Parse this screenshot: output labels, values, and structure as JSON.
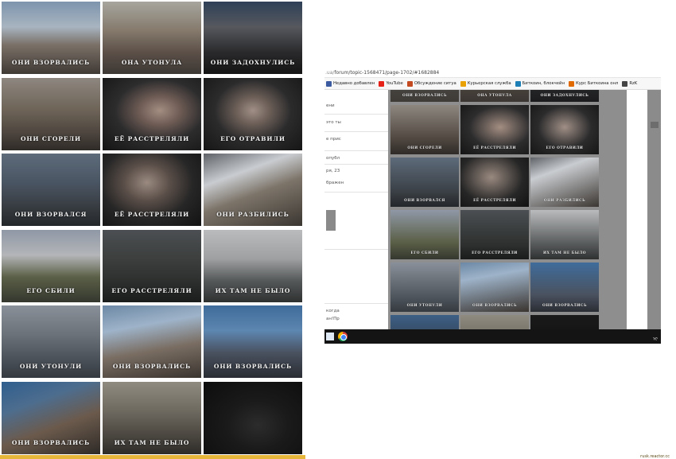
{
  "collage": {
    "tiles": [
      {
        "label": "ОНИ ВЗОРВАЛИСЬ",
        "bg": "linear-gradient(180deg,#7d94ad 0%,#a8b4c0 35%,#7a7067 60%,#403a35 100%)"
      },
      {
        "label": "ОНА УТОНУЛА",
        "bg": "linear-gradient(180deg,#a7a59e 0%,#857a6c 40%,#5c5048 70%,#3c3834 100%)"
      },
      {
        "label": "ОНИ ЗАДОХНУЛИСЬ",
        "bg": "linear-gradient(180deg,#2e4057 0%,#56585e 35%,#2a2a2c 70%,#141414 100%)"
      },
      {
        "label": "ОНИ СГОРЕЛИ",
        "bg": "linear-gradient(180deg,#8e8780 0%,#6d6357 45%,#4e463f 75%,#2f2b28 100%)"
      },
      {
        "label": "ЕЁ РАССТРЕЛЯЛИ",
        "bg": "radial-gradient(ellipse at 58% 45%,#a48e82 0%,#6f5c55 25%,#2c2c2d 55%,#141414 100%)"
      },
      {
        "label": "ЕГО ОТРАВИЛИ",
        "bg": "radial-gradient(ellipse at 50% 45%,#a08f86 0%,#6a5d56 25%,#2b2b2c 55%,#161616 100%)"
      },
      {
        "label": "ОНИ ВЗОРВАЛСЯ",
        "bg": "linear-gradient(180deg,#5d6b7a 0%,#4a5563 40%,#3a3f45 70%,#24272a 100%)"
      },
      {
        "label": "ЕЁ РАССТРЕЛЯЛИ",
        "bg": "radial-gradient(ellipse at 45% 40%,#9a8a80 0%,#5a4e48 30%,#262626 60%,#121212 100%)"
      },
      {
        "label": "ОНИ РАЗБИЛИСЬ",
        "bg": "linear-gradient(160deg,#5f6368 0%,#c9ccd0 30%,#7c7469 55%,#3b3631 100%)"
      },
      {
        "label": "ЕГО СБИЛИ",
        "bg": "linear-gradient(180deg,#8f98a6 0%,#b3b5b8 35%,#5b6047 65%,#34372e 100%)"
      },
      {
        "label": "ЕГО РАССТРЕЛЯЛИ",
        "bg": "linear-gradient(180deg,#4c4f53 0%,#3c3f3d 40%,#2d302e 70%,#1b1c1c 100%)"
      },
      {
        "label": "ИХ ТАМ НЕ БЫЛО",
        "bg": "linear-gradient(180deg,#b9bbbd 0%,#9ea0a1 40%,#56595a 70%,#2f3131 100%)"
      },
      {
        "label": "ОНИ УТОНУЛИ",
        "bg": "linear-gradient(180deg,#8a9099 0%,#6c7279 40%,#4e555c 70%,#353a40 100%)"
      },
      {
        "label": "ОНИ ВЗОРВАЛИСЬ",
        "bg": "linear-gradient(170deg,#6c88a5 0%,#9eb3c9 30%,#7a6e63 60%,#3a342f 100%)"
      },
      {
        "label": "ОНИ ВЗОРВАЛИСЬ",
        "bg": "linear-gradient(180deg,#3f6c9b 0%,#5d86b0 35%,#4a5260 65%,#2a2d33 100%)"
      },
      {
        "label": "ОНИ ВЗОРВАЛИСЬ",
        "bg": "linear-gradient(160deg,#2f5e8e 0%,#4d6d8e 30%,#6b5a4c 60%,#2e2a27 100%)"
      },
      {
        "label": "ИХ ТАМ НЕ БЫЛО",
        "bg": "linear-gradient(180deg,#8f8b80 0%,#6f6a60 40%,#4f4b44 70%,#2e2c29 100%)"
      },
      {
        "label": "",
        "bg": "radial-gradient(ellipse at 55% 60%,#2c2c2c 0%,#1a1a1a 40%,#0d0d0d 100%)"
      }
    ],
    "strip_color": "#e6b63a",
    "watermark": "rusk.reactor.cc"
  },
  "browser": {
    "url": "forum/topic-1568471/page-1702/#1682884",
    "bookmarks": [
      {
        "label": "Недавно добавлен",
        "icon": "k-icon",
        "color": "#3b5aa0"
      },
      {
        "label": "YouTube",
        "icon": "youtube-icon",
        "color": "#e62117"
      },
      {
        "label": "Обсуждение ситуа",
        "icon": "bike-icon",
        "color": "#c44b21"
      },
      {
        "label": "Курьерская служба",
        "icon": "courier-icon",
        "color": "#e8a100"
      },
      {
        "label": "Биткоин, блокчейн",
        "icon": "bitcoin-icon",
        "color": "#1d7fb5"
      },
      {
        "label": "Курс Биткоина онл",
        "icon": "chart-icon",
        "color": "#e06a00"
      },
      {
        "label": "RzK",
        "icon": "rzk-icon",
        "color": "#444444"
      }
    ],
    "forum_snippets": [
      "ени",
      "это ты",
      "е прис",
      "опубл",
      "ря, 23",
      "бражен",
      "когда",
      "ан!Пр"
    ],
    "mini_tiles": [
      {
        "label": "ОНИ ВЗОРВАЛИСЬ",
        "bg": "linear-gradient(180deg,#5c5a56 0%,#3e3b37 100%)"
      },
      {
        "label": "ОНА УТОНУЛА",
        "bg": "linear-gradient(180deg,#6a5f55 0%,#3b3632 100%)"
      },
      {
        "label": "ОНИ ЗАДОХНУЛИСЬ",
        "bg": "linear-gradient(180deg,#3c3e42 0%,#1c1c1e 100%)"
      },
      {
        "label": "ОНИ СГОРЕЛИ",
        "bg": "linear-gradient(180deg,#8e8780 0%,#4e463f 70%,#2f2b28 100%)"
      },
      {
        "label": "ЕЁ РАССТРЕЛЯЛИ",
        "bg": "radial-gradient(ellipse at 58% 45%,#a48e82 0%,#2c2c2d 55%,#141414 100%)"
      },
      {
        "label": "ЕГО ОТРАВИЛИ",
        "bg": "radial-gradient(ellipse at 50% 45%,#a08f86 0%,#2b2b2c 55%,#161616 100%)"
      },
      {
        "label": "ОНИ ВЗОРВАЛСЯ",
        "bg": "linear-gradient(180deg,#5d6b7a 0%,#3a3f45 70%,#24272a 100%)"
      },
      {
        "label": "ЕЁ РАССТРЕЛЯЛИ",
        "bg": "radial-gradient(ellipse at 45% 40%,#9a8a80 0%,#262626 60%,#121212 100%)"
      },
      {
        "label": "ОНИ РАЗБИЛИСЬ",
        "bg": "linear-gradient(160deg,#5f6368 0%,#c9ccd0 30%,#3b3631 100%)"
      },
      {
        "label": "ЕГО СБИЛИ",
        "bg": "linear-gradient(180deg,#8f98a6 0%,#5b6047 65%,#34372e 100%)"
      },
      {
        "label": "ЕГО РАССТРЕЛЯЛИ",
        "bg": "linear-gradient(180deg,#4c4f53 0%,#2d302e 70%,#1b1c1c 100%)"
      },
      {
        "label": "ИХ ТАМ НЕ БЫЛО",
        "bg": "linear-gradient(180deg,#b9bbbd 0%,#56595a 70%,#2f3131 100%)"
      },
      {
        "label": "ОНИ УТОНУЛИ",
        "bg": "linear-gradient(180deg,#8a9099 0%,#4e555c 70%,#353a40 100%)"
      },
      {
        "label": "ОНИ ВЗОРВАЛИСЬ",
        "bg": "linear-gradient(170deg,#6c88a5 0%,#9eb3c9 30%,#3a342f 100%)"
      },
      {
        "label": "ОНИ ВЗОРВАЛИСЬ",
        "bg": "linear-gradient(180deg,#3f6c9b 0%,#4a5260 65%,#2a2d33 100%)"
      },
      {
        "label": "",
        "bg": "linear-gradient(180deg,#3d5f85 0%,#2b2d30 100%)"
      },
      {
        "label": "",
        "bg": "linear-gradient(180deg,#8f8b80 0%,#4f4b44 100%)"
      },
      {
        "label": "",
        "bg": "linear-gradient(180deg,#1a1a1a 0%,#0d0d0d 100%)"
      }
    ],
    "tray_text": "ᢈ"
  }
}
